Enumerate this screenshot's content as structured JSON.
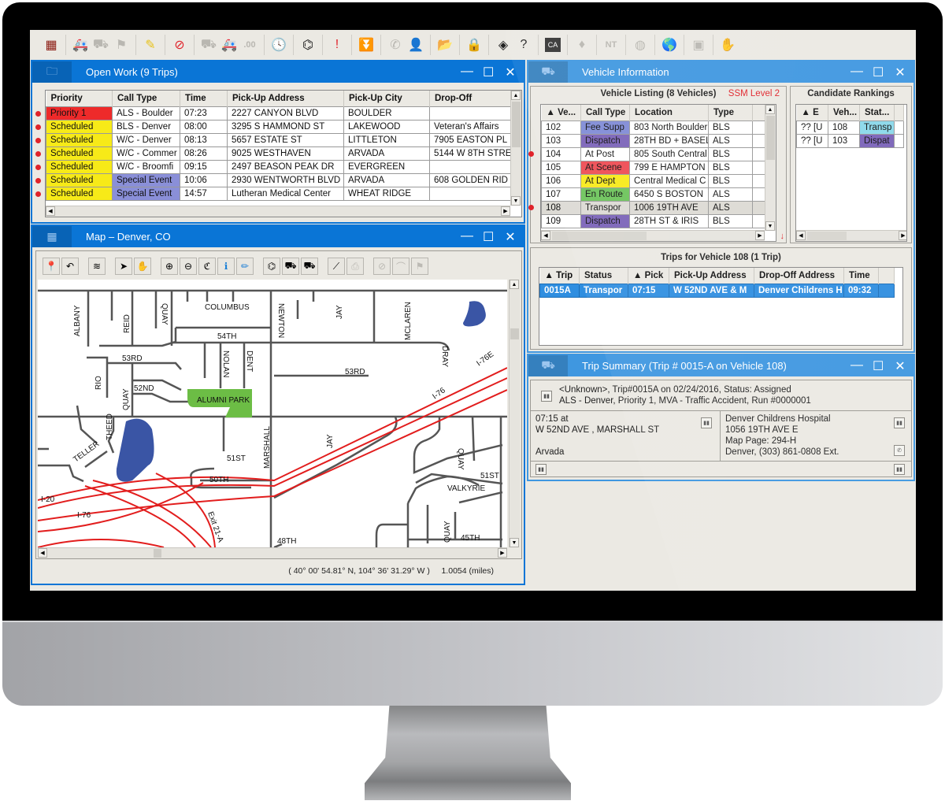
{
  "toolbar": {
    "icons": [
      {
        "name": "calendar-grid-icon",
        "glyph": "▦",
        "enabled": true,
        "color": "#8b1b12"
      },
      {
        "name": "ambulance-assign-icon",
        "glyph": "🚑",
        "enabled": true
      },
      {
        "name": "ambulance-unassign-icon",
        "glyph": "⛟",
        "enabled": false
      },
      {
        "name": "route-flag-icon",
        "glyph": "⚑",
        "enabled": false
      },
      {
        "name": "pencil-icon",
        "glyph": "✎",
        "enabled": true,
        "color": "#e8c21a"
      },
      {
        "name": "cancel-icon",
        "glyph": "⊘",
        "enabled": true,
        "color": "#e0232a"
      },
      {
        "name": "ambulance-forward-icon",
        "glyph": "⛟",
        "enabled": false
      },
      {
        "name": "ambulance-back-icon",
        "glyph": "🚑",
        "enabled": true
      },
      {
        "name": "decimal-icon",
        "glyph": ".00",
        "enabled": false
      },
      {
        "name": "clock-icon",
        "glyph": "🕓",
        "enabled": true
      },
      {
        "name": "binoculars-icon",
        "glyph": "⌬",
        "enabled": true
      },
      {
        "name": "alert-icon",
        "glyph": "!",
        "enabled": true,
        "color": "#e0232a"
      },
      {
        "name": "filter-icon",
        "glyph": "⏬",
        "enabled": true
      },
      {
        "name": "phone-icon",
        "glyph": "✆",
        "enabled": false
      },
      {
        "name": "user-icon",
        "glyph": "👤",
        "enabled": false
      },
      {
        "name": "folder-open-icon",
        "glyph": "📂",
        "enabled": true
      },
      {
        "name": "lock-icon",
        "glyph": "🔒",
        "enabled": true
      },
      {
        "name": "diamond-grid-icon",
        "glyph": "◈",
        "enabled": true
      },
      {
        "name": "help-icon",
        "glyph": "?",
        "enabled": true
      },
      {
        "name": "ca-icon",
        "glyph": "CA",
        "enabled": true
      },
      {
        "name": "diamond-icon",
        "glyph": "♦",
        "enabled": false
      },
      {
        "name": "nt-icon",
        "glyph": "NT",
        "enabled": false
      },
      {
        "name": "globe-gray-icon",
        "glyph": "◍",
        "enabled": false
      },
      {
        "name": "globe-icon",
        "glyph": "🌎",
        "enabled": true
      },
      {
        "name": "camera-icon",
        "glyph": "▣",
        "enabled": false
      },
      {
        "name": "hand-icon",
        "glyph": "✋",
        "enabled": false
      }
    ]
  },
  "open_work": {
    "title": "Open Work (9 Trips)",
    "columns": [
      "Priority",
      "Call Type",
      "Time",
      "Pick-Up Address",
      "Pick-Up City",
      "Drop-Off"
    ],
    "rows": [
      {
        "priority": "Priority 1",
        "priority_color": "#ee2a2a",
        "call_type": "ALS - Boulder",
        "call_color": "",
        "time": "07:23",
        "address": "2227 CANYON BLVD",
        "city": "BOULDER",
        "dropoff": ""
      },
      {
        "priority": "Scheduled",
        "priority_color": "#f7ea18",
        "call_type": "BLS - Denver",
        "call_color": "",
        "time": "08:00",
        "address": "3295 S HAMMOND ST",
        "city": "LAKEWOOD",
        "dropoff": "Veteran's Affairs"
      },
      {
        "priority": "Scheduled",
        "priority_color": "#f7ea18",
        "call_type": "W/C - Denver",
        "call_color": "",
        "time": "08:13",
        "address": "5657 ESTATE ST",
        "city": "LITTLETON",
        "dropoff": "7905 EASTON PL"
      },
      {
        "priority": "Scheduled",
        "priority_color": "#f7ea18",
        "call_type": "W/C - Commer",
        "call_color": "",
        "time": "08:26",
        "address": "9025 WESTHAVEN",
        "city": "ARVADA",
        "dropoff": "5144 W 8TH STRE"
      },
      {
        "priority": "Scheduled",
        "priority_color": "#f7ea18",
        "call_type": "W/C - Broomfi",
        "call_color": "",
        "time": "09:15",
        "address": "2497 BEASON PEAK DR",
        "city": "EVERGREEN",
        "dropoff": ""
      },
      {
        "priority": "Scheduled",
        "priority_color": "#f7ea18",
        "call_type": "Special Event",
        "call_color": "#8a8fd8",
        "time": "10:06",
        "address": "2930 WENTWORTH BLVD",
        "city": "ARVADA",
        "dropoff": "608 GOLDEN RID"
      },
      {
        "priority": "Scheduled",
        "priority_color": "#f7ea18",
        "call_type": "Special Event",
        "call_color": "#8a8fd8",
        "time": "14:57",
        "address": "Lutheran Medical Center",
        "city": "WHEAT RIDGE",
        "dropoff": ""
      }
    ]
  },
  "map_window": {
    "title": "Map – Denver, CO",
    "tools": [
      {
        "name": "map-pin-icon",
        "glyph": "📍",
        "enabled": true
      },
      {
        "name": "undo-icon",
        "glyph": "↶",
        "enabled": true
      },
      {
        "name": "layers-icon",
        "glyph": "≋",
        "enabled": true
      },
      {
        "name": "pointer-icon",
        "glyph": "➤",
        "enabled": true
      },
      {
        "name": "pan-hand-icon",
        "glyph": "✋",
        "enabled": true
      },
      {
        "name": "zoom-in-icon",
        "glyph": "⊕",
        "enabled": true
      },
      {
        "name": "zoom-out-icon",
        "glyph": "⊖",
        "enabled": true
      },
      {
        "name": "zoom-extent-icon",
        "glyph": "ℭ",
        "enabled": true
      },
      {
        "name": "info-icon",
        "glyph": "ℹ",
        "enabled": true
      },
      {
        "name": "draw-icon",
        "glyph": "✏",
        "enabled": true
      },
      {
        "name": "find-icon",
        "glyph": "⌬",
        "enabled": true
      },
      {
        "name": "vehicles-icon",
        "glyph": "⛟",
        "enabled": true
      },
      {
        "name": "vehicles-route-icon",
        "glyph": "⛟",
        "enabled": true
      },
      {
        "name": "measure-icon",
        "glyph": "⟋",
        "enabled": true
      },
      {
        "name": "print-icon",
        "glyph": "⎙",
        "enabled": false
      },
      {
        "name": "block-icon",
        "glyph": "⊘",
        "enabled": false
      },
      {
        "name": "arc-icon",
        "glyph": "⌒",
        "enabled": false
      },
      {
        "name": "flag-icon",
        "glyph": "⚑",
        "enabled": false
      }
    ],
    "labels": {
      "albany": "ALBANY",
      "reid": "REID",
      "quay": "QUAY",
      "columbus": "COLUMBUS",
      "newton": "NEWTON",
      "jay": "JAY",
      "mclaren": "MCLAREN",
      "th54": "54TH",
      "nolan": "NOLAN",
      "dent": "DENT",
      "rd53": "53RD",
      "dray": "DRAY",
      "i76e": "I-76E",
      "rio": "RIO",
      "nd52": "52ND",
      "park": "ALUMNI PARK",
      "i76": "I-76",
      "theed": "THEED",
      "teller": "TELLER",
      "marshall": "MARSHALL",
      "st51": "51ST",
      "th50": "50TH",
      "i20": "I-20",
      "exit": "Exit 21-A",
      "th48": "48TH",
      "valkyrie": "VALKYRIE",
      "th45": "45TH"
    },
    "status_coords": "( 40° 00' 54.81° N, 104° 36' 31.29° W )",
    "status_scale": "1.0054 (miles)"
  },
  "vehicle_info": {
    "title": "Vehicle Information",
    "listing_title": "Vehicle Listing (8 Vehicles)",
    "ssm_level": "SSM Level 2",
    "columns": [
      "Ve...",
      "Call Type",
      "Location",
      "Type"
    ],
    "rows": [
      {
        "vehicle": "102",
        "status": "Fee Supp",
        "status_color": "#7f8ad6",
        "location": "803 North Boulder",
        "type": "BLS",
        "alert": false
      },
      {
        "vehicle": "103",
        "status": "Dispatch",
        "status_color": "#7a62b8",
        "location": "28TH BD + BASEL",
        "type": "ALS",
        "alert": true
      },
      {
        "vehicle": "104",
        "status": "At Post",
        "status_color": "#ffffff",
        "location": "805 South Central",
        "type": "BLS",
        "alert": false
      },
      {
        "vehicle": "105",
        "status": "At Scene",
        "status_color": "#ee4a52",
        "location": "799 E HAMPTON",
        "type": "BLS",
        "alert": false
      },
      {
        "vehicle": "106",
        "status": "At Dept",
        "status_color": "#f7ea18",
        "location": "Central Medical C",
        "type": "BLS",
        "alert": false
      },
      {
        "vehicle": "107",
        "status": "En Route",
        "status_color": "#6cc35a",
        "location": "6450 S BOSTON",
        "type": "ALS",
        "alert": true
      },
      {
        "vehicle": "108",
        "status": "Transpor",
        "status_color": "#dcdad4",
        "location": "1006 19TH AVE",
        "type": "ALS",
        "alert": false,
        "selected": true
      },
      {
        "vehicle": "109",
        "status": "Dispatch",
        "status_color": "#7a62b8",
        "location": "28TH ST & IRIS",
        "type": "BLS",
        "alert": false
      }
    ],
    "candidates_title": "Candidate Rankings",
    "candidate_columns": [
      "E",
      "Veh...",
      "Stat..."
    ],
    "candidates": [
      {
        "e": "?? [U",
        "vehicle": "108",
        "status": "Transp",
        "status_color": "#8ad8ea"
      },
      {
        "e": "?? [U",
        "vehicle": "103",
        "status": "Dispat",
        "status_color": "#7a62b8"
      }
    ],
    "trips_title": "Trips for Vehicle 108 (1 Trip)",
    "trip_columns": [
      "Trip",
      "Status",
      "Pick",
      "Pick-Up Address",
      "Drop-Off Address",
      "Time"
    ],
    "trips": [
      {
        "trip": "0015A",
        "status": "Transpor",
        "pick": "07:15",
        "pickup": "W 52ND AVE & M",
        "dropoff": "Denver Childrens H",
        "time": "09:32"
      }
    ]
  },
  "trip_summary": {
    "title": "Trip Summary (Trip # 0015-A on Vehicle 108)",
    "line1": "<Unknown>, Trip#0015A on 02/24/2016, Status: Assigned",
    "line2": "ALS - Denver, Priority 1, MVA - Traffic Accident, Run #0000001",
    "pickup_time": "07:15 at",
    "pickup_address": "W 52ND AVE , MARSHALL ST",
    "pickup_city": "Arvada",
    "dropoff_name": "Denver Childrens Hospital",
    "dropoff_address": "1056 19TH AVE E",
    "dropoff_map": "Map Page: 294-H",
    "dropoff_phone": "Denver, (303) 861-0808 Ext."
  },
  "window_controls": {
    "minimize": "—",
    "maximize": "☐",
    "close": "✕"
  }
}
